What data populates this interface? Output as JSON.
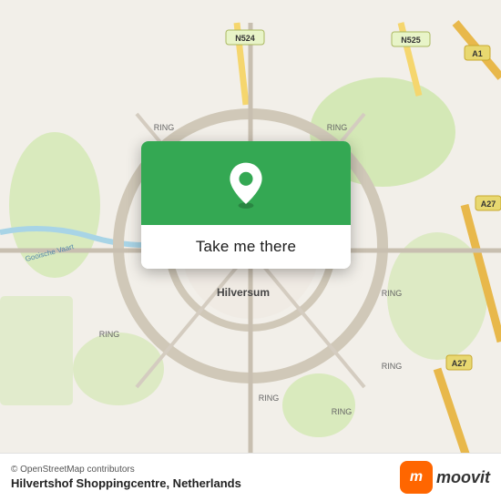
{
  "map": {
    "background_color": "#f2efe9",
    "center_city": "Hilversum",
    "country": "Netherlands"
  },
  "popup": {
    "button_label": "Take me there",
    "pin_icon": "location-pin"
  },
  "bottom_bar": {
    "credit": "© OpenStreetMap contributors",
    "location_name": "Hilvertshof Shoppingcentre, Netherlands",
    "moovit_label": "moovit"
  }
}
